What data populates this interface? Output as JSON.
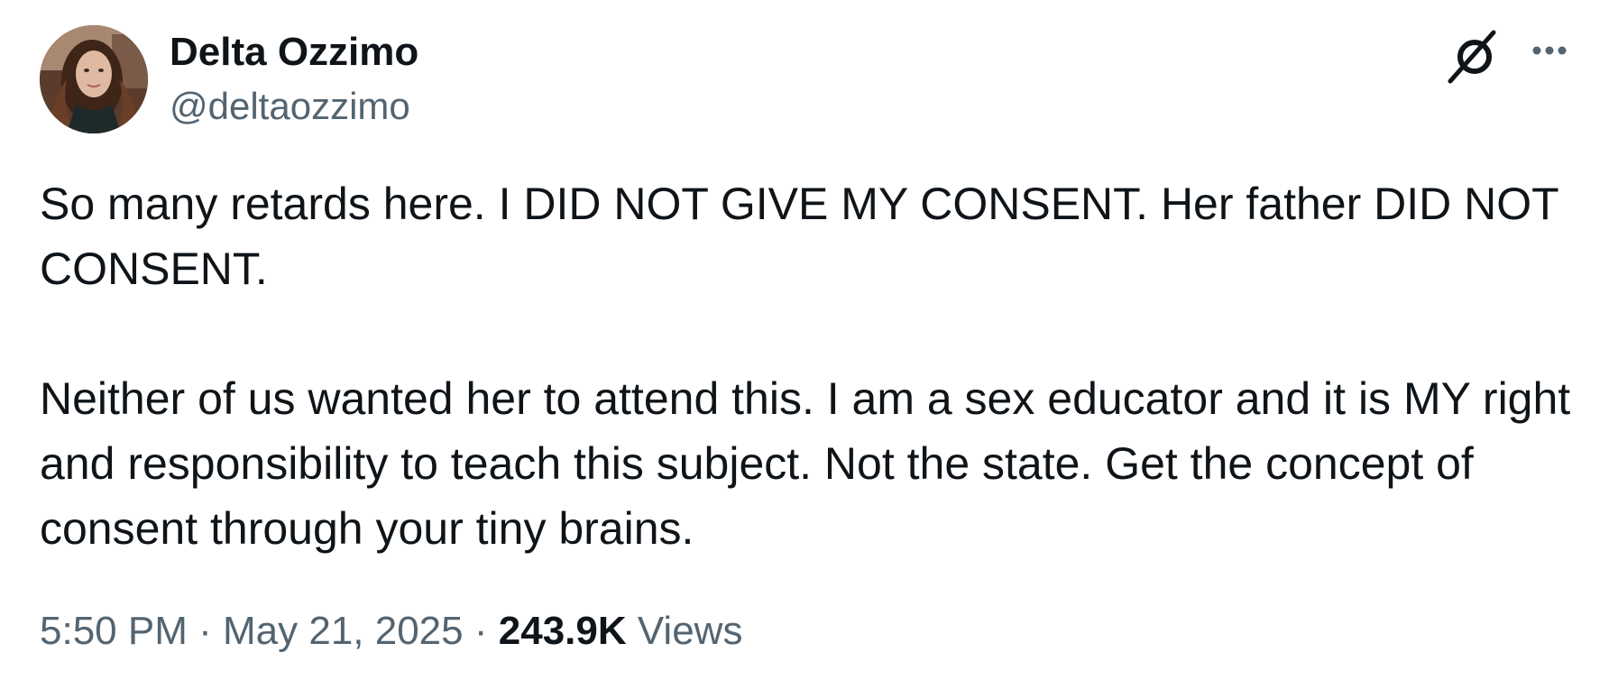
{
  "author": {
    "display_name": "Delta Ozzimo",
    "handle": "@deltaozzimo",
    "avatar_icon": "profile-photo"
  },
  "header_icons": {
    "grok": "grok-icon",
    "more": "more-options-icon"
  },
  "tweet": {
    "paragraphs": [
      "So many retards here. I DID NOT GIVE MY CONSENT. Her father DID NOT CONSENT.",
      "Neither of us wanted her to attend this. I am a sex educator and it is MY right and responsibility to teach this subject. Not the state. Get the concept of consent through your tiny brains."
    ]
  },
  "meta": {
    "time": "5:50 PM",
    "separator": "·",
    "date": "May 21, 2025",
    "views_count": "243.9K",
    "views_label": "Views"
  },
  "colors": {
    "text_primary": "#0f1419",
    "text_secondary": "#536471",
    "background": "#ffffff"
  }
}
